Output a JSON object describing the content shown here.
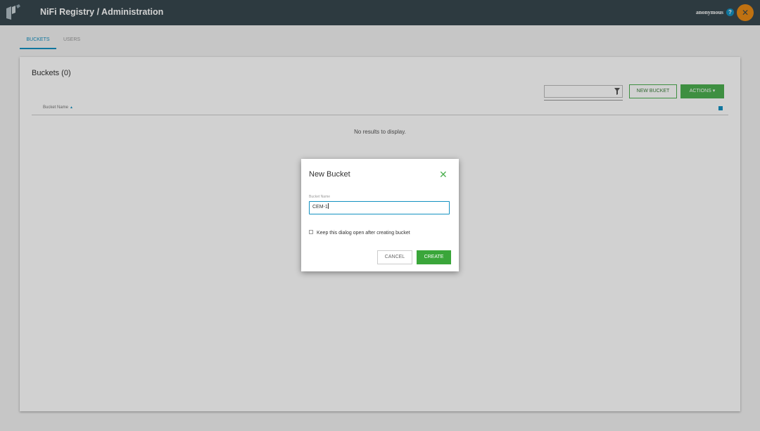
{
  "header": {
    "title": "NiFi Registry / Administration",
    "user": "anonymous",
    "help_glyph": "?",
    "close_glyph": "✕"
  },
  "tabs": [
    {
      "label": "BUCKETS",
      "active": true
    },
    {
      "label": "USERS",
      "active": false
    }
  ],
  "main": {
    "title": "Buckets (0)",
    "filter_placeholder": "",
    "new_bucket_label": "NEW BUCKET",
    "actions_label": "ACTIONS",
    "column_name": "Bucket Name",
    "empty_message": "No results to display."
  },
  "dialog": {
    "title": "New Bucket",
    "field_label": "Bucket Name",
    "field_value": "CEM-1",
    "keep_open_label": "Keep this dialog open after creating bucket",
    "cancel_label": "CANCEL",
    "create_label": "CREATE",
    "close_glyph": "✕"
  },
  "colors": {
    "topbar": "#37474f",
    "accent": "#1491c1",
    "green": "#4caf50",
    "orange": "#e98a15"
  }
}
